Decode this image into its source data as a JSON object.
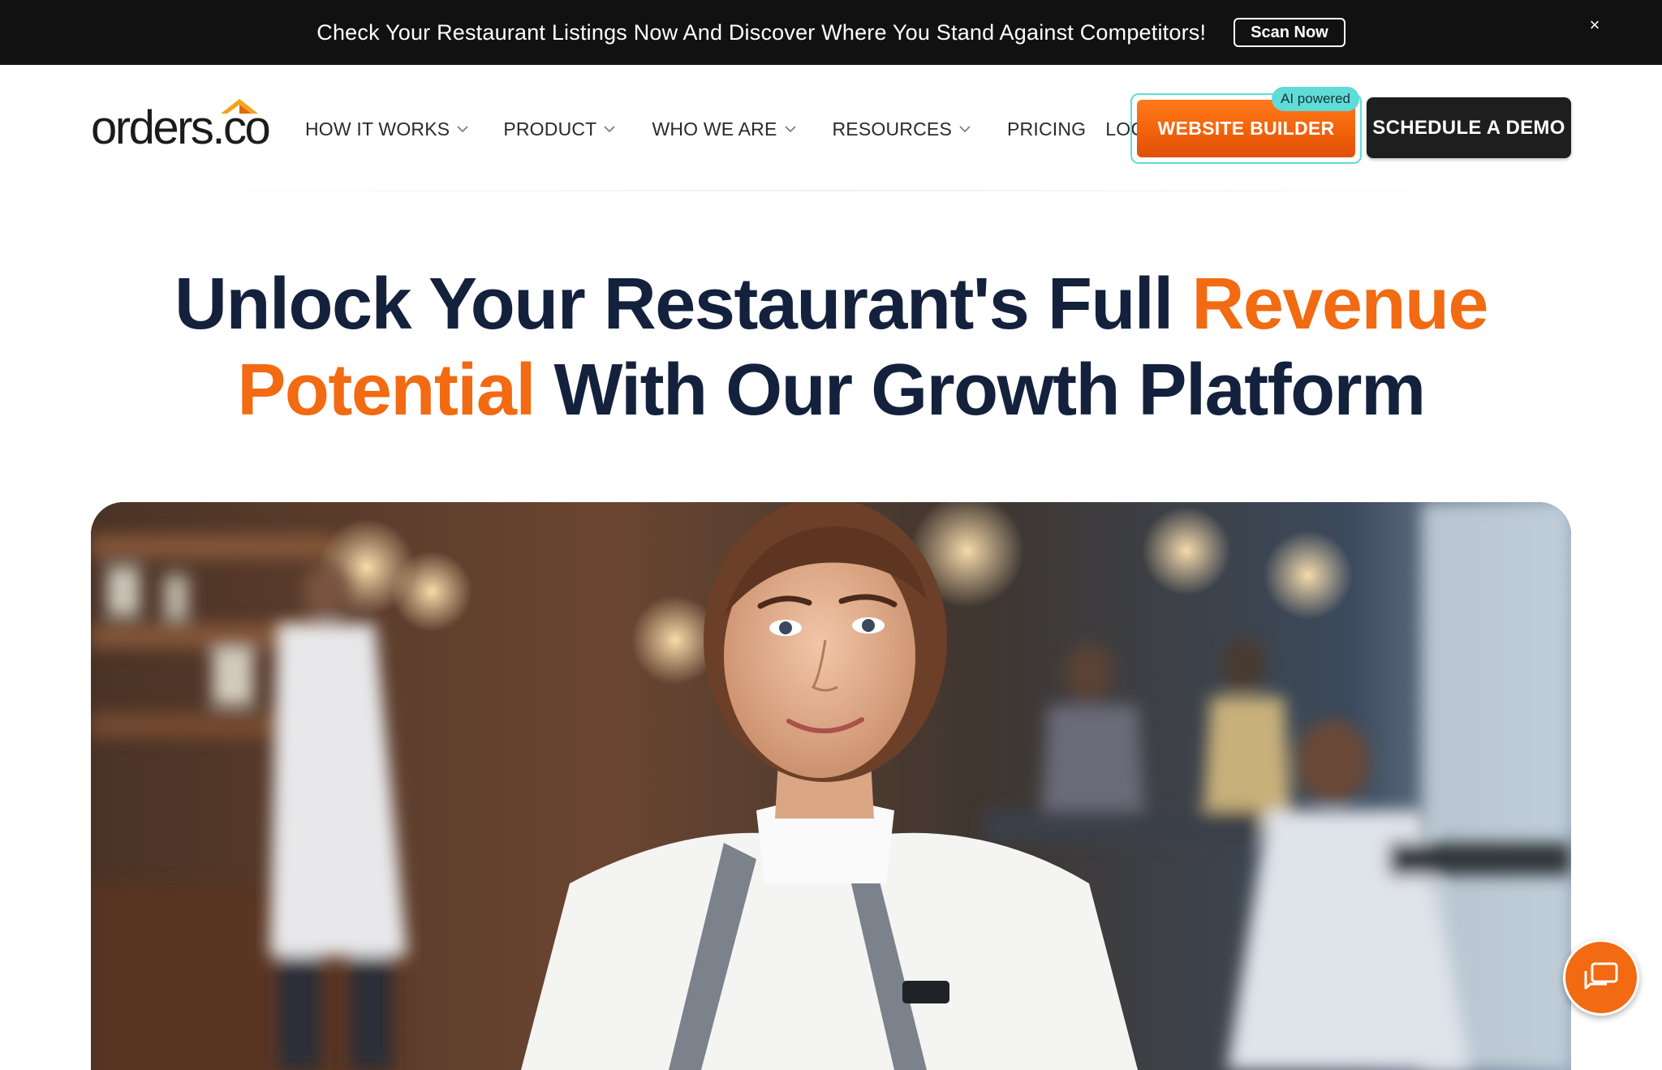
{
  "promo": {
    "text": "Check Your Restaurant Listings Now And Discover Where You Stand Against Competitors!",
    "button_label": "Scan Now",
    "close_glyph": "×"
  },
  "header": {
    "logo_text": "orders.co",
    "nav": [
      {
        "label": "HOW IT WORKS",
        "has_dropdown": true
      },
      {
        "label": "PRODUCT",
        "has_dropdown": true
      },
      {
        "label": "WHO WE ARE",
        "has_dropdown": true
      },
      {
        "label": "RESOURCES",
        "has_dropdown": true
      },
      {
        "label": "PRICING",
        "has_dropdown": false
      },
      {
        "label": "LOGIN",
        "has_dropdown": false
      }
    ],
    "builder_button": "WEBSITE BUILDER",
    "ai_badge": "AI powered",
    "demo_button": "SCHEDULE A DEMO"
  },
  "hero": {
    "headline_part1": "Unlock Your Restaurant's Full ",
    "headline_accent1": "Revenue",
    "headline_accent2": "Potential",
    "headline_part2": " With Our Growth Platform"
  },
  "colors": {
    "brand_orange": "#f26a12",
    "navy": "#14213d",
    "teal_badge": "#5fdcd8",
    "promo_bg": "#111111"
  },
  "icons": {
    "close": "close-icon",
    "chevron": "chevron-down-icon",
    "chat": "chat-icon"
  }
}
